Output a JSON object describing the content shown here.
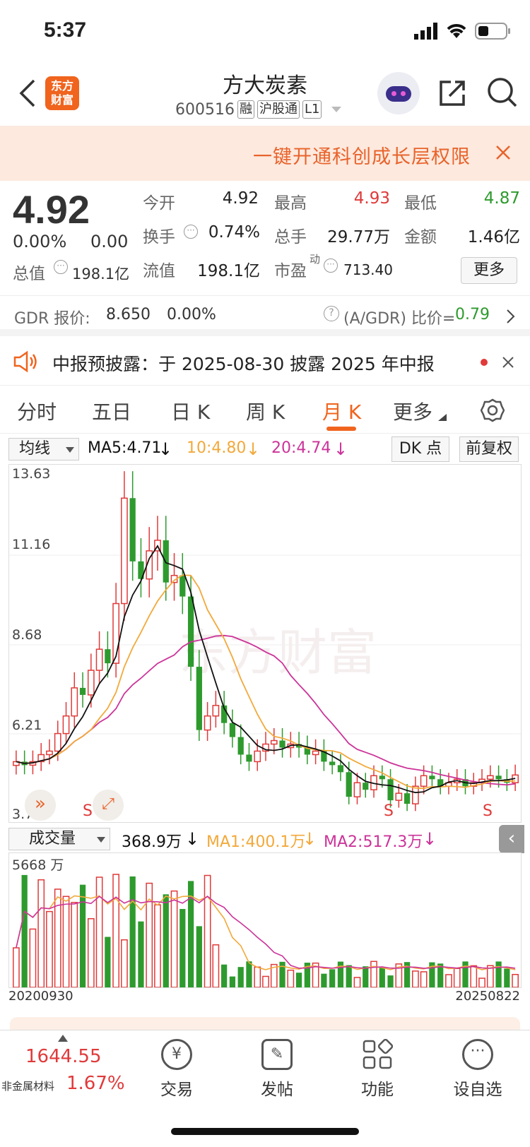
{
  "status_bar": {
    "time": "5:37"
  },
  "header": {
    "logo_text_1": "东方",
    "logo_text_2": "财富",
    "title": "方大炭素",
    "code": "600516",
    "tags": [
      "融",
      "沪股通",
      "L1"
    ]
  },
  "banner": {
    "text": "一键开通科创成长层权限"
  },
  "quote": {
    "price": "4.92",
    "change_pct": "0.00%",
    "change": "0.00",
    "total_value_label": "总值",
    "total_value": "198.1亿",
    "fields": [
      {
        "label": "今开",
        "value": "4.92"
      },
      {
        "label": "最高",
        "value": "4.93"
      },
      {
        "label": "最低",
        "value": "4.87"
      },
      {
        "label": "换手",
        "value": "0.74%"
      },
      {
        "label": "总手",
        "value": "29.77万"
      },
      {
        "label": "金额",
        "value": "1.46亿"
      },
      {
        "label": "流值",
        "value": "198.1亿"
      },
      {
        "label": "市盈",
        "value": "713.40"
      }
    ],
    "pe_sup": "动",
    "more_label": "更多"
  },
  "gdr": {
    "label": "GDR 报价:",
    "price": "8.650",
    "pct": "0.00%",
    "ratio_label": "(A/GDR) 比价=",
    "ratio": "0.79"
  },
  "notice": {
    "text": "中报预披露：于 2025-08-30 披露 2025 年中报"
  },
  "tabs": [
    "分时",
    "五日",
    "日 K",
    "周 K",
    "月 K",
    "更多"
  ],
  "active_tab": "月 K",
  "ma": {
    "selector": "均线",
    "ma5": "MA5:4.71",
    "ma10": "10:4.80",
    "ma20": "20:4.74",
    "dk": "DK 点",
    "fq": "前复权"
  },
  "colors": {
    "up": "#e03a3a",
    "down": "#2e9a2e",
    "ma5": "#111111",
    "ma10": "#f2a93b",
    "ma20": "#cc3399",
    "accent": "#f0641e"
  },
  "price_axis": [
    "13.63",
    "11.16",
    "8.68",
    "6.21",
    "3.74"
  ],
  "watermark": "东方财富",
  "markers": [
    "S",
    "S",
    "S"
  ],
  "volume": {
    "selector": "成交量",
    "value": "368.9万",
    "ma1": "MA1:400.1万",
    "ma2": "MA2:517.3万",
    "max_label": "5668 万"
  },
  "dates": {
    "start": "20200930",
    "end": "20250822"
  },
  "bottom": {
    "index_value": "1644.55",
    "index_name": "非金属材料",
    "index_pct": "1.67%",
    "items": [
      "交易",
      "发帖",
      "功能",
      "设自选"
    ]
  },
  "chart_data": {
    "type": "candlestick",
    "ylim": [
      3.74,
      13.63
    ],
    "close_approx": [
      5.3,
      5.2,
      5.3,
      5.5,
      5.6,
      6.1,
      6.6,
      7.4,
      7.2,
      7.9,
      8.5,
      8.1,
      9.8,
      12.8,
      11.0,
      10.5,
      11.3,
      11.6,
      10.4,
      10.6,
      10.0,
      8.0,
      6.2,
      6.6,
      6.9,
      6.4,
      6.0,
      5.5,
      5.3,
      5.6,
      5.8,
      5.9,
      5.7,
      5.8,
      5.7,
      5.5,
      5.6,
      5.3,
      5.2,
      5.0,
      4.3,
      4.7,
      4.5,
      4.9,
      4.8,
      4.2,
      4.4,
      4.1,
      4.6,
      4.9,
      4.8,
      4.6,
      4.7,
      4.8,
      4.6,
      4.7,
      4.8,
      4.9,
      4.8,
      4.7,
      4.92
    ]
  }
}
